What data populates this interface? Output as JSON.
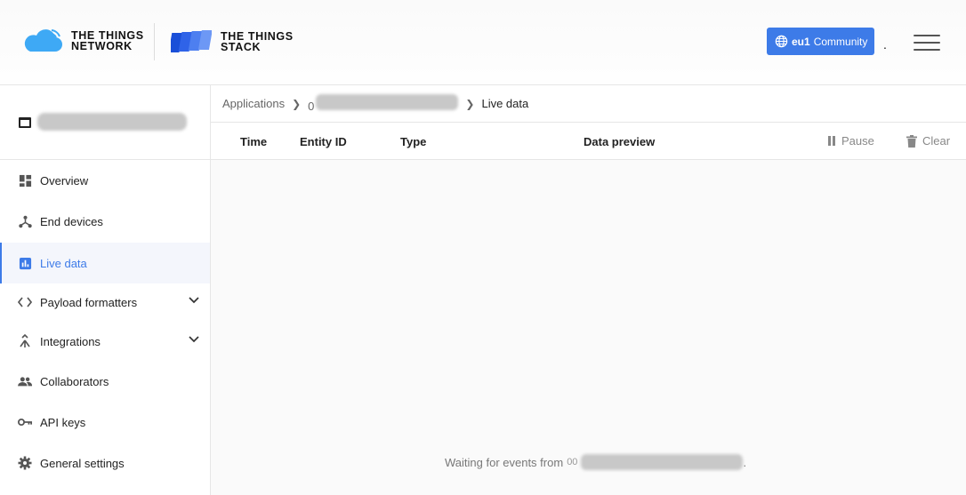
{
  "header": {
    "ttn_logo_line1": "THE THINGS",
    "ttn_logo_line2": "NETWORK",
    "stack_logo_line1": "THE THINGS",
    "stack_logo_line2": "STACK",
    "cluster_region": "eu1",
    "cluster_label": "Community",
    "trailing_dot": ".",
    "brand_color": "#3d7be8"
  },
  "sidebar": {
    "app_icon": "application-window-icon",
    "items": [
      {
        "label": "Overview",
        "icon": "dashboard-icon"
      },
      {
        "label": "End devices",
        "icon": "device-hub-icon"
      },
      {
        "label": "Live data",
        "icon": "bar-chart-icon",
        "active": true
      },
      {
        "label": "Payload formatters",
        "icon": "code-icon",
        "expandable": true
      },
      {
        "label": "Integrations",
        "icon": "merge-icon",
        "expandable": true
      },
      {
        "label": "Collaborators",
        "icon": "people-icon"
      },
      {
        "label": "API keys",
        "icon": "key-icon"
      },
      {
        "label": "General settings",
        "icon": "gear-icon"
      }
    ]
  },
  "breadcrumb": {
    "root": "Applications",
    "app_prefix": "0",
    "current": "Live data"
  },
  "table": {
    "columns": [
      "Time",
      "Entity ID",
      "Type",
      "Data preview"
    ],
    "pause_label": "Pause",
    "clear_label": "Clear"
  },
  "empty_state": {
    "text": "Waiting for events from",
    "id_prefix": "00",
    "suffix": "."
  }
}
